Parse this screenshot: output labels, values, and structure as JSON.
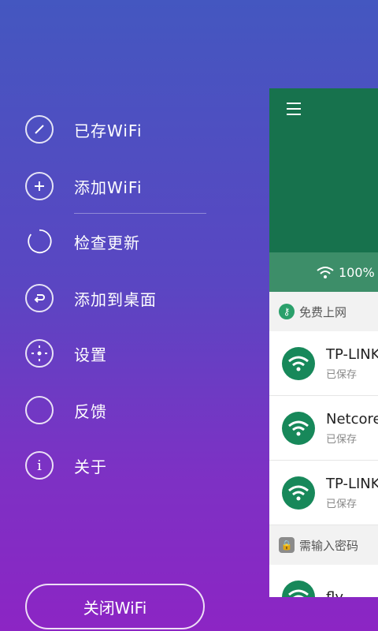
{
  "menu": {
    "items": [
      {
        "label": "已存WiFi",
        "icon": "edit-icon"
      },
      {
        "label": "添加WiFi",
        "icon": "plus-icon"
      },
      {
        "label": "检查更新",
        "icon": "refresh-icon"
      },
      {
        "label": "添加到桌面",
        "icon": "return-icon"
      },
      {
        "label": "设置",
        "icon": "settings-icon"
      },
      {
        "label": "反馈",
        "icon": "feedback-icon"
      },
      {
        "label": "关于",
        "icon": "info-icon"
      }
    ],
    "close_wifi": "关闭WiFi"
  },
  "preview": {
    "signal": "100%",
    "free_section": "免费上网",
    "password_section": "需输入密码",
    "networks": [
      {
        "name": "TP-LINK",
        "status": "已保存"
      },
      {
        "name": "Netcore",
        "status": "已保存"
      },
      {
        "name": "TP-LINK",
        "status": "已保存"
      },
      {
        "name": "fly",
        "status": ""
      }
    ]
  },
  "colors": {
    "bg_top": "#4457c0",
    "bg_bottom": "#8c25c4",
    "panel_green": "#17724d",
    "wifi_circle": "#17885a"
  }
}
